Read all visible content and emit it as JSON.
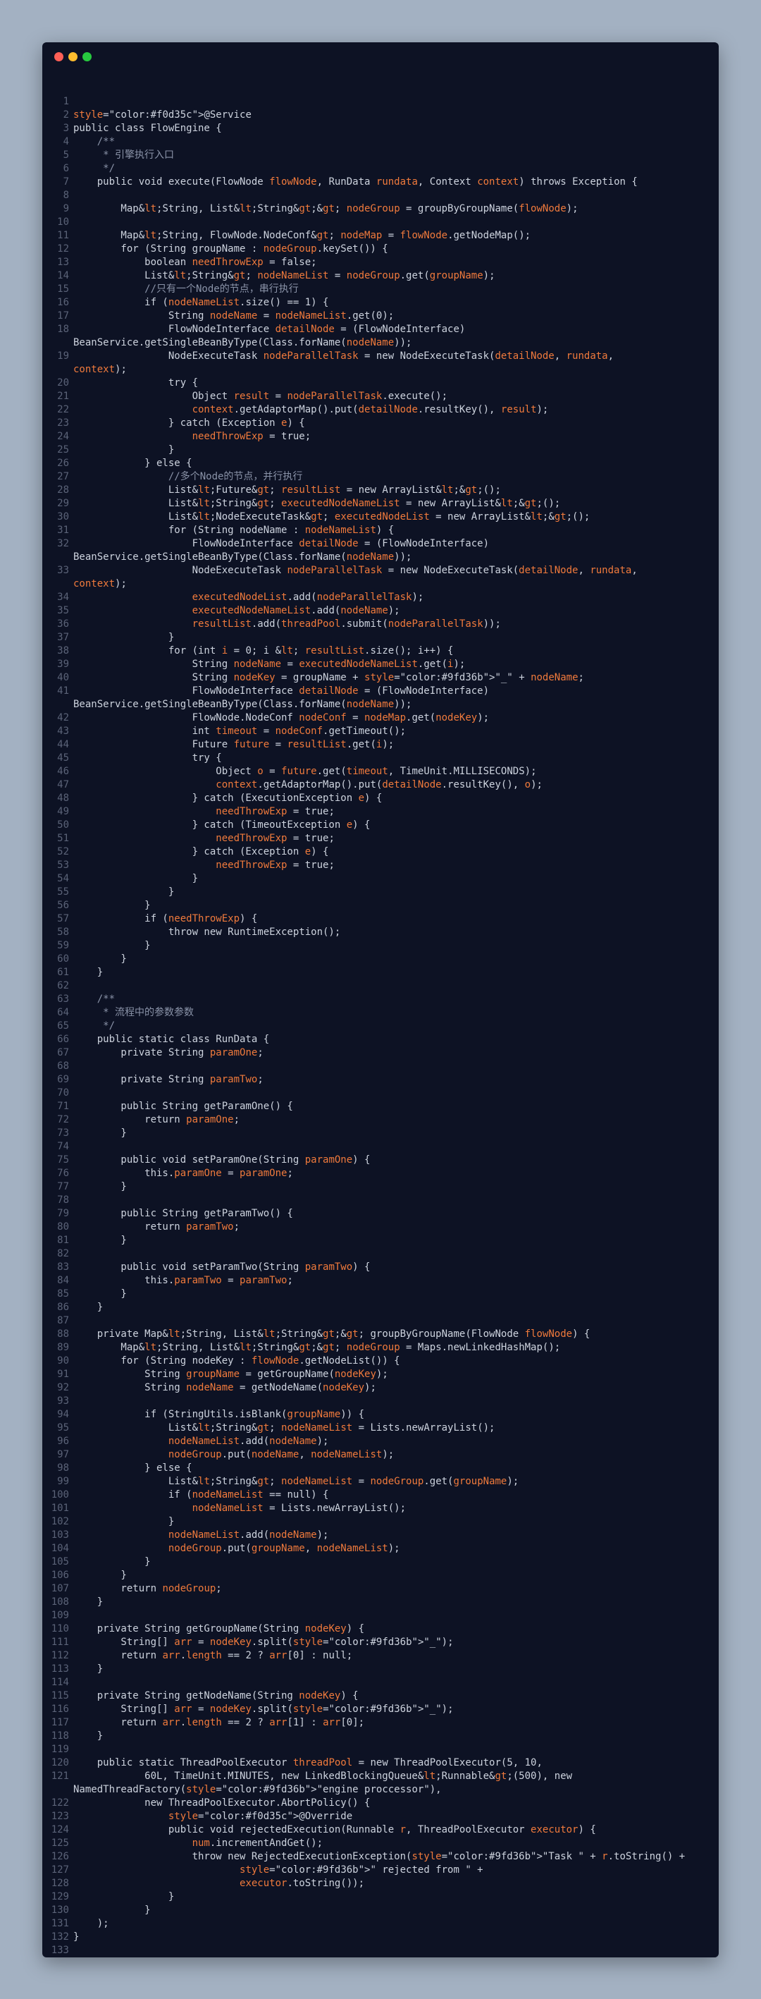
{
  "window": {
    "buttons": [
      "close",
      "minimize",
      "maximize"
    ]
  },
  "colors": {
    "background": "#a3b1c2",
    "editor": "#0d1224",
    "text": "#cdd3de",
    "line_number": "#5b6378",
    "identifier": "#f07a3c",
    "annotation": "#f0d35c",
    "string": "#9fd36b"
  },
  "code_lines": [
    {
      "n": "1",
      "t": ""
    },
    {
      "n": "2",
      "t": "@Service"
    },
    {
      "n": "3",
      "t": "public class FlowEngine {"
    },
    {
      "n": "4",
      "t": "    /**"
    },
    {
      "n": "5",
      "t": "     * 引擎执行入口"
    },
    {
      "n": "6",
      "t": "     */"
    },
    {
      "n": "7",
      "t": "    public void execute(FlowNode flowNode, RunData rundata, Context context) throws Exception {"
    },
    {
      "n": "8",
      "t": ""
    },
    {
      "n": "9",
      "t": "        Map<String, List<String>> nodeGroup = groupByGroupName(flowNode);"
    },
    {
      "n": "10",
      "t": ""
    },
    {
      "n": "11",
      "t": "        Map<String, FlowNode.NodeConf> nodeMap = flowNode.getNodeMap();"
    },
    {
      "n": "12",
      "t": "        for (String groupName : nodeGroup.keySet()) {"
    },
    {
      "n": "13",
      "t": "            boolean needThrowExp = false;"
    },
    {
      "n": "14",
      "t": "            List<String> nodeNameList = nodeGroup.get(groupName);"
    },
    {
      "n": "15",
      "t": "            //只有一个Node的节点，串行执行"
    },
    {
      "n": "16",
      "t": "            if (nodeNameList.size() == 1) {"
    },
    {
      "n": "17",
      "t": "                String nodeName = nodeNameList.get(0);"
    },
    {
      "n": "18",
      "t": "                FlowNodeInterface detailNode = (FlowNodeInterface)"
    },
    {
      "n": "",
      "t": "BeanService.getSingleBeanByType(Class.forName(nodeName));"
    },
    {
      "n": "19",
      "t": "                NodeExecuteTask nodeParallelTask = new NodeExecuteTask(detailNode, rundata,"
    },
    {
      "n": "",
      "t": "context);"
    },
    {
      "n": "20",
      "t": "                try {"
    },
    {
      "n": "21",
      "t": "                    Object result = nodeParallelTask.execute();"
    },
    {
      "n": "22",
      "t": "                    context.getAdaptorMap().put(detailNode.resultKey(), result);"
    },
    {
      "n": "23",
      "t": "                } catch (Exception e) {"
    },
    {
      "n": "24",
      "t": "                    needThrowExp = true;"
    },
    {
      "n": "25",
      "t": "                }"
    },
    {
      "n": "26",
      "t": "            } else {"
    },
    {
      "n": "27",
      "t": "                //多个Node的节点，并行执行"
    },
    {
      "n": "28",
      "t": "                List<Future> resultList = new ArrayList<>();"
    },
    {
      "n": "29",
      "t": "                List<String> executedNodeNameList = new ArrayList<>();"
    },
    {
      "n": "30",
      "t": "                List<NodeExecuteTask> executedNodeList = new ArrayList<>();"
    },
    {
      "n": "31",
      "t": "                for (String nodeName : nodeNameList) {"
    },
    {
      "n": "32",
      "t": "                    FlowNodeInterface detailNode = (FlowNodeInterface)"
    },
    {
      "n": "",
      "t": "BeanService.getSingleBeanByType(Class.forName(nodeName));"
    },
    {
      "n": "33",
      "t": "                    NodeExecuteTask nodeParallelTask = new NodeExecuteTask(detailNode, rundata,"
    },
    {
      "n": "",
      "t": "context);"
    },
    {
      "n": "34",
      "t": "                    executedNodeList.add(nodeParallelTask);"
    },
    {
      "n": "35",
      "t": "                    executedNodeNameList.add(nodeName);"
    },
    {
      "n": "36",
      "t": "                    resultList.add(threadPool.submit(nodeParallelTask));"
    },
    {
      "n": "37",
      "t": "                }"
    },
    {
      "n": "38",
      "t": "                for (int i = 0; i < resultList.size(); i++) {"
    },
    {
      "n": "39",
      "t": "                    String nodeName = executedNodeNameList.get(i);"
    },
    {
      "n": "40",
      "t": "                    String nodeKey = groupName + \"_\" + nodeName;"
    },
    {
      "n": "41",
      "t": "                    FlowNodeInterface detailNode = (FlowNodeInterface)"
    },
    {
      "n": "",
      "t": "BeanService.getSingleBeanByType(Class.forName(nodeName));"
    },
    {
      "n": "42",
      "t": "                    FlowNode.NodeConf nodeConf = nodeMap.get(nodeKey);"
    },
    {
      "n": "43",
      "t": "                    int timeout = nodeConf.getTimeout();"
    },
    {
      "n": "44",
      "t": "                    Future future = resultList.get(i);"
    },
    {
      "n": "45",
      "t": "                    try {"
    },
    {
      "n": "46",
      "t": "                        Object o = future.get(timeout, TimeUnit.MILLISECONDS);"
    },
    {
      "n": "47",
      "t": "                        context.getAdaptorMap().put(detailNode.resultKey(), o);"
    },
    {
      "n": "48",
      "t": "                    } catch (ExecutionException e) {"
    },
    {
      "n": "49",
      "t": "                        needThrowExp = true;"
    },
    {
      "n": "50",
      "t": "                    } catch (TimeoutException e) {"
    },
    {
      "n": "51",
      "t": "                        needThrowExp = true;"
    },
    {
      "n": "52",
      "t": "                    } catch (Exception e) {"
    },
    {
      "n": "53",
      "t": "                        needThrowExp = true;"
    },
    {
      "n": "54",
      "t": "                    }"
    },
    {
      "n": "55",
      "t": "                }"
    },
    {
      "n": "56",
      "t": "            }"
    },
    {
      "n": "57",
      "t": "            if (needThrowExp) {"
    },
    {
      "n": "58",
      "t": "                throw new RuntimeException();"
    },
    {
      "n": "59",
      "t": "            }"
    },
    {
      "n": "60",
      "t": "        }"
    },
    {
      "n": "61",
      "t": "    }"
    },
    {
      "n": "62",
      "t": ""
    },
    {
      "n": "63",
      "t": "    /**"
    },
    {
      "n": "64",
      "t": "     * 流程中的参数参数"
    },
    {
      "n": "65",
      "t": "     */"
    },
    {
      "n": "66",
      "t": "    public static class RunData {"
    },
    {
      "n": "67",
      "t": "        private String paramOne;"
    },
    {
      "n": "68",
      "t": ""
    },
    {
      "n": "69",
      "t": "        private String paramTwo;"
    },
    {
      "n": "70",
      "t": ""
    },
    {
      "n": "71",
      "t": "        public String getParamOne() {"
    },
    {
      "n": "72",
      "t": "            return paramOne;"
    },
    {
      "n": "73",
      "t": "        }"
    },
    {
      "n": "74",
      "t": ""
    },
    {
      "n": "75",
      "t": "        public void setParamOne(String paramOne) {"
    },
    {
      "n": "76",
      "t": "            this.paramOne = paramOne;"
    },
    {
      "n": "77",
      "t": "        }"
    },
    {
      "n": "78",
      "t": ""
    },
    {
      "n": "79",
      "t": "        public String getParamTwo() {"
    },
    {
      "n": "80",
      "t": "            return paramTwo;"
    },
    {
      "n": "81",
      "t": "        }"
    },
    {
      "n": "82",
      "t": ""
    },
    {
      "n": "83",
      "t": "        public void setParamTwo(String paramTwo) {"
    },
    {
      "n": "84",
      "t": "            this.paramTwo = paramTwo;"
    },
    {
      "n": "85",
      "t": "        }"
    },
    {
      "n": "86",
      "t": "    }"
    },
    {
      "n": "87",
      "t": ""
    },
    {
      "n": "88",
      "t": "    private Map<String, List<String>> groupByGroupName(FlowNode flowNode) {"
    },
    {
      "n": "89",
      "t": "        Map<String, List<String>> nodeGroup = Maps.newLinkedHashMap();"
    },
    {
      "n": "90",
      "t": "        for (String nodeKey : flowNode.getNodeList()) {"
    },
    {
      "n": "91",
      "t": "            String groupName = getGroupName(nodeKey);"
    },
    {
      "n": "92",
      "t": "            String nodeName = getNodeName(nodeKey);"
    },
    {
      "n": "93",
      "t": ""
    },
    {
      "n": "94",
      "t": "            if (StringUtils.isBlank(groupName)) {"
    },
    {
      "n": "95",
      "t": "                List<String> nodeNameList = Lists.newArrayList();"
    },
    {
      "n": "96",
      "t": "                nodeNameList.add(nodeName);"
    },
    {
      "n": "97",
      "t": "                nodeGroup.put(nodeName, nodeNameList);"
    },
    {
      "n": "98",
      "t": "            } else {"
    },
    {
      "n": "99",
      "t": "                List<String> nodeNameList = nodeGroup.get(groupName);"
    },
    {
      "n": "100",
      "t": "                if (nodeNameList == null) {"
    },
    {
      "n": "101",
      "t": "                    nodeNameList = Lists.newArrayList();"
    },
    {
      "n": "102",
      "t": "                }"
    },
    {
      "n": "103",
      "t": "                nodeNameList.add(nodeName);"
    },
    {
      "n": "104",
      "t": "                nodeGroup.put(groupName, nodeNameList);"
    },
    {
      "n": "105",
      "t": "            }"
    },
    {
      "n": "106",
      "t": "        }"
    },
    {
      "n": "107",
      "t": "        return nodeGroup;"
    },
    {
      "n": "108",
      "t": "    }"
    },
    {
      "n": "109",
      "t": ""
    },
    {
      "n": "110",
      "t": "    private String getGroupName(String nodeKey) {"
    },
    {
      "n": "111",
      "t": "        String[] arr = nodeKey.split(\"_\");"
    },
    {
      "n": "112",
      "t": "        return arr.length == 2 ? arr[0] : null;"
    },
    {
      "n": "113",
      "t": "    }"
    },
    {
      "n": "114",
      "t": ""
    },
    {
      "n": "115",
      "t": "    private String getNodeName(String nodeKey) {"
    },
    {
      "n": "116",
      "t": "        String[] arr = nodeKey.split(\"_\");"
    },
    {
      "n": "117",
      "t": "        return arr.length == 2 ? arr[1] : arr[0];"
    },
    {
      "n": "118",
      "t": "    }"
    },
    {
      "n": "119",
      "t": ""
    },
    {
      "n": "120",
      "t": "    public static ThreadPoolExecutor threadPool = new ThreadPoolExecutor(5, 10,"
    },
    {
      "n": "121",
      "t": "            60L, TimeUnit.MINUTES, new LinkedBlockingQueue<Runnable>(500), new"
    },
    {
      "n": "",
      "t": "NamedThreadFactory(\"engine proccessor\"),"
    },
    {
      "n": "122",
      "t": "            new ThreadPoolExecutor.AbortPolicy() {"
    },
    {
      "n": "123",
      "t": "                @Override"
    },
    {
      "n": "124",
      "t": "                public void rejectedExecution(Runnable r, ThreadPoolExecutor executor) {"
    },
    {
      "n": "125",
      "t": "                    num.incrementAndGet();"
    },
    {
      "n": "126",
      "t": "                    throw new RejectedExecutionException(\"Task \" + r.toString() +"
    },
    {
      "n": "127",
      "t": "                            \" rejected from \" +"
    },
    {
      "n": "128",
      "t": "                            executor.toString());"
    },
    {
      "n": "129",
      "t": "                }"
    },
    {
      "n": "130",
      "t": "            }"
    },
    {
      "n": "131",
      "t": "    );"
    },
    {
      "n": "132",
      "t": "}"
    },
    {
      "n": "133",
      "t": ""
    }
  ]
}
